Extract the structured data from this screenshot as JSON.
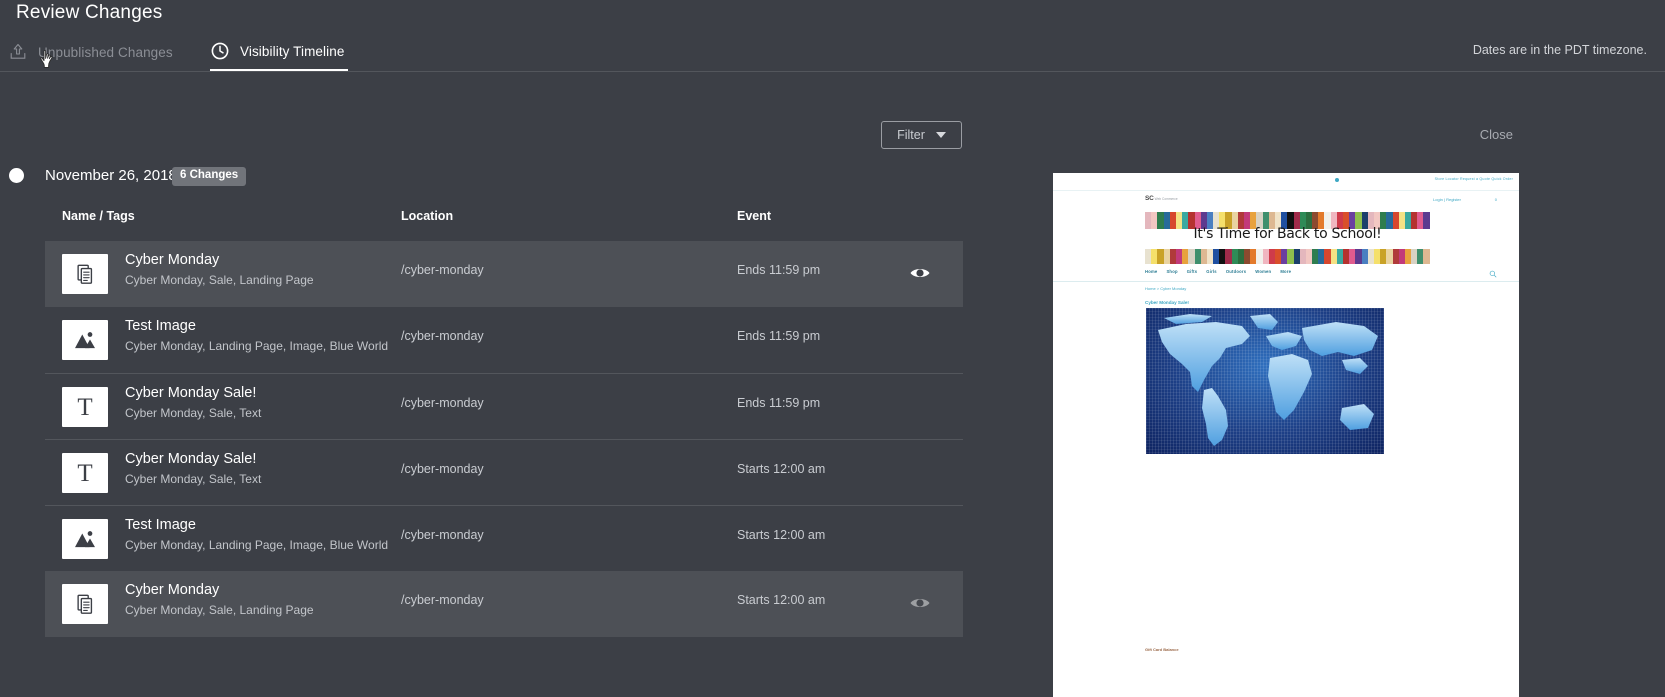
{
  "page_title": "Review Changes",
  "tabs": [
    {
      "label": "Unpublished Changes",
      "icon": "upload-icon",
      "active": false
    },
    {
      "label": "Visibility Timeline",
      "icon": "clock-icon",
      "active": true
    }
  ],
  "timezone_note": "Dates are in the PDT timezone.",
  "toolbar": {
    "filter_label": "Filter",
    "close_label": "Close"
  },
  "group": {
    "date": "November 26, 2018",
    "changes_badge": "6 Changes"
  },
  "table": {
    "headers": {
      "name": "Name / Tags",
      "location": "Location",
      "event": "Event"
    },
    "rows": [
      {
        "icon": "document-icon",
        "name": "Cyber Monday",
        "tags": "Cyber Monday, Sale, Landing Page",
        "location": "/cyber-monday",
        "event": "Ends 11:59 pm",
        "has_eye": true,
        "eye_dim": false,
        "highlight": true
      },
      {
        "icon": "image-icon",
        "name": "Test Image",
        "tags": "Cyber Monday, Landing Page, Image, Blue World",
        "location": "/cyber-monday",
        "event": "Ends 11:59 pm",
        "has_eye": false,
        "eye_dim": false,
        "highlight": false
      },
      {
        "icon": "text-icon",
        "name": "Cyber Monday Sale!",
        "tags": "Cyber Monday, Sale, Text",
        "location": "/cyber-monday",
        "event": "Ends 11:59 pm",
        "has_eye": false,
        "eye_dim": false,
        "highlight": false
      },
      {
        "icon": "text-icon",
        "name": "Cyber Monday Sale!",
        "tags": "Cyber Monday, Sale, Text",
        "location": "/cyber-monday",
        "event": "Starts 12:00 am",
        "has_eye": false,
        "eye_dim": false,
        "highlight": false
      },
      {
        "icon": "image-icon",
        "name": "Test Image",
        "tags": "Cyber Monday, Landing Page, Image, Blue World",
        "location": "/cyber-monday",
        "event": "Starts 12:00 am",
        "has_eye": false,
        "eye_dim": false,
        "highlight": false
      },
      {
        "icon": "document-icon",
        "name": "Cyber Monday",
        "tags": "Cyber Monday, Sale, Landing Page",
        "location": "/cyber-monday",
        "event": "Starts 12:00 am",
        "has_eye": true,
        "eye_dim": true,
        "highlight": true
      }
    ]
  },
  "preview": {
    "utility_links": "Store Locator   Request a Quote   Quick Order",
    "logo": "SC",
    "logo_sub": "Web Commerce",
    "account_links": "Login  |  Register",
    "cart": "0",
    "banner_text": "It's Time for Back to School!",
    "nav_items": [
      "Home",
      "Shop",
      "Gifts",
      "Girls",
      "Outdoors",
      "Women",
      "More"
    ],
    "breadcrumb": "Home  >  Cyber Monday",
    "heading": "Cyber Monday Sale!",
    "footer_link": "Gift Card Balance"
  },
  "colors": {
    "background": "#3c3f46",
    "row_highlight": "#4d5056",
    "border": "#53565c",
    "text_primary": "#ffffff",
    "text_secondary": "#c2c5ca",
    "text_muted": "#8b8e95",
    "badge": "#71747a",
    "preview_accent": "#3ea8c4"
  }
}
